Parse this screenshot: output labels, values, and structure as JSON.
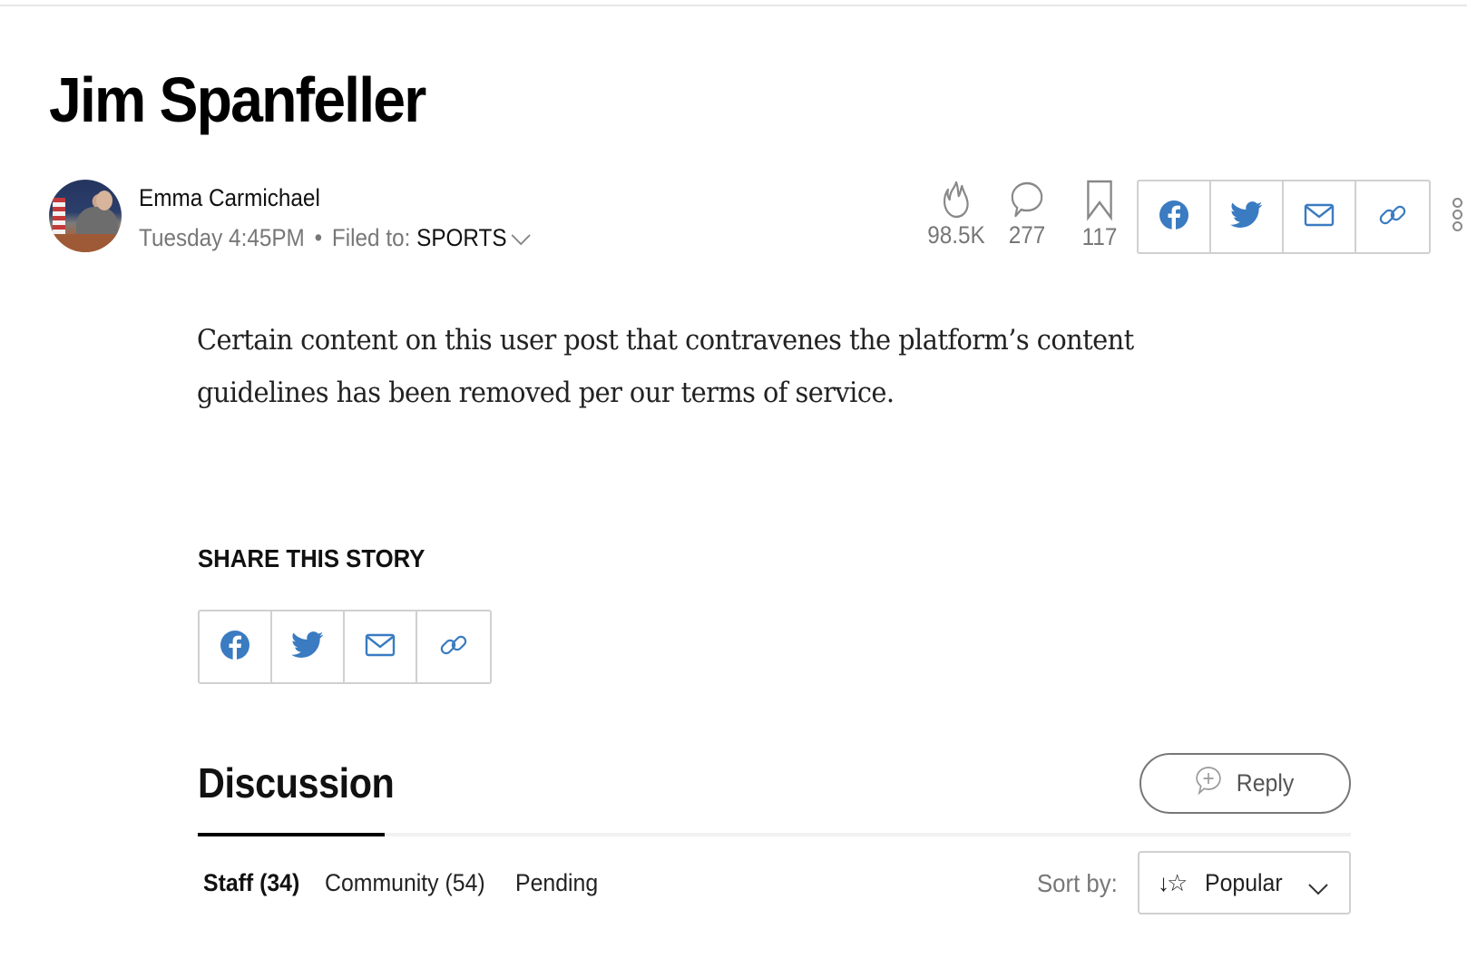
{
  "article": {
    "title": "Jim Spanfeller",
    "author": "Emma Carmichael",
    "timestamp": "Tuesday 4:45PM",
    "separator": "•",
    "filed_to_label": "Filed to:",
    "section": "SPORTS",
    "body": "Certain content on this user post that contravenes the platform’s content guidelines has been removed per our terms of service."
  },
  "stats": {
    "views": {
      "icon": "flame-icon",
      "value": "98.5K"
    },
    "comments": {
      "icon": "comment-bubble-icon",
      "value": "277"
    },
    "saves": {
      "icon": "bookmark-icon",
      "value": "117"
    }
  },
  "share": {
    "label": "SHARE THIS STORY",
    "buttons": [
      {
        "icon": "facebook-icon",
        "label": "Facebook"
      },
      {
        "icon": "twitter-icon",
        "label": "Twitter"
      },
      {
        "icon": "email-icon",
        "label": "Email"
      },
      {
        "icon": "link-icon",
        "label": "Copy link"
      }
    ],
    "accent_color": "#3a7bc1"
  },
  "discussion": {
    "title": "Discussion",
    "reply_label": "Reply",
    "tabs": [
      {
        "label": "Staff (34)",
        "active": true
      },
      {
        "label": "Community (54)",
        "active": false
      },
      {
        "label": "Pending",
        "active": false
      }
    ],
    "sort_label": "Sort by:",
    "sort_value": "Popular"
  }
}
